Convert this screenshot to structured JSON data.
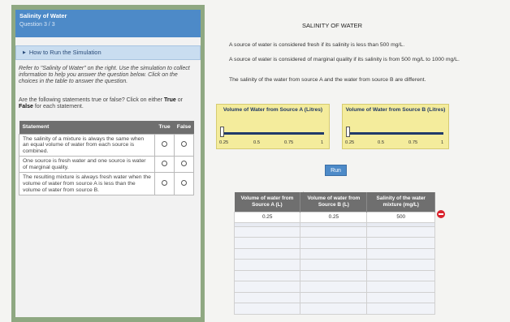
{
  "header": {
    "title": "Salinity of Water",
    "subtitle": "Question 3 / 3"
  },
  "howto": {
    "label": "How to Run the Simulation"
  },
  "instructions": "Refer to \"Salinity of Water\" on the right. Use the simulation to collect information to help you answer the question below. Click on the choices in the table to answer the question.",
  "question": {
    "prefix": "Are the following statements true or false? Click on either ",
    "true": "True",
    "mid": " or ",
    "false": "False",
    "suffix": " for each statement."
  },
  "statements": {
    "headers": [
      "Statement",
      "True",
      "False"
    ],
    "rows": [
      "The salinity of a mixture is always the same when an equal volume of water from each source is combined.",
      "One source is fresh water and one source is water of marginal quality.",
      "The resulting mixture is always fresh water when the volume of water from source A is less than the volume of water from source B."
    ]
  },
  "main": {
    "heading": "SALINITY OF WATER",
    "para1": "A source of water is considered fresh if its salinity is less than 500 mg/L.",
    "para2": "A source of water is considered of marginal quality if its salinity is from 500 mg/L to 1000 mg/L.",
    "para3": "The salinity of the water from source A and the water from source B are different."
  },
  "sliders": {
    "a": {
      "title": "Volume of Water from Source A (Litres)",
      "ticks": [
        "0.25",
        "0.5",
        "0.75",
        "1"
      ],
      "value": 0.25
    },
    "b": {
      "title": "Volume of Water from Source B (Litres)",
      "ticks": [
        "0.25",
        "0.5",
        "0.75",
        "1"
      ],
      "value": 0.25
    }
  },
  "run": {
    "label": "Run"
  },
  "results": {
    "headers": [
      "Volume of water from Source A (L)",
      "Volume of water from Source B (L)",
      "Salinity of the water mixture (mg/L)"
    ],
    "rows": [
      [
        "0.25",
        "0.25",
        "500"
      ]
    ]
  },
  "colors": {
    "accent": "#4d8ac8",
    "panel": "#8fa882",
    "slider_bg": "#f4ec9c",
    "delete": "#d9232d"
  },
  "icons": {
    "delete": "delete-row-icon",
    "howto": "triangle-right-icon",
    "cursor": "mouse-cursor-icon"
  }
}
